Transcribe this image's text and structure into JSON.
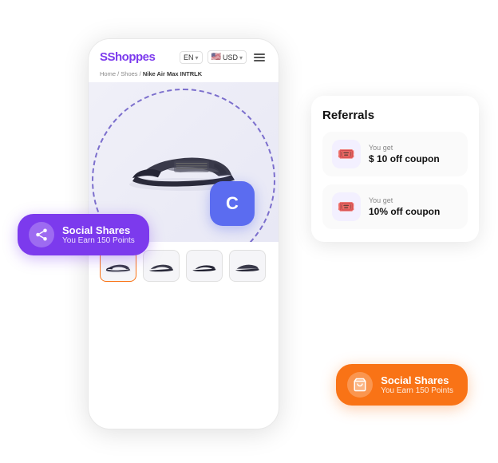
{
  "app": {
    "logo_text": "Shoppes",
    "logo_accent": "s"
  },
  "header": {
    "lang": "EN",
    "currency": "USD",
    "flag": "🇺🇸"
  },
  "breadcrumb": {
    "items": [
      "Home",
      "Shoes",
      "Nike Air Max INTRLK"
    ]
  },
  "referrals": {
    "title": "Referrals",
    "coupons": [
      {
        "you_get_label": "You get",
        "value": "$ 10 off coupon"
      },
      {
        "you_get_label": "You get",
        "value": "10% off coupon"
      }
    ]
  },
  "badges": {
    "left": {
      "title": "Social Shares",
      "subtitle": "You Earn 150 Points"
    },
    "right": {
      "title": "Social Shares",
      "subtitle": "You Earn 150 Points"
    }
  },
  "c_logo": "C",
  "colors": {
    "purple": "#7c3aed",
    "blue": "#5b6cf0",
    "orange": "#f97316",
    "coupon_bg": "#f3f0ff"
  }
}
